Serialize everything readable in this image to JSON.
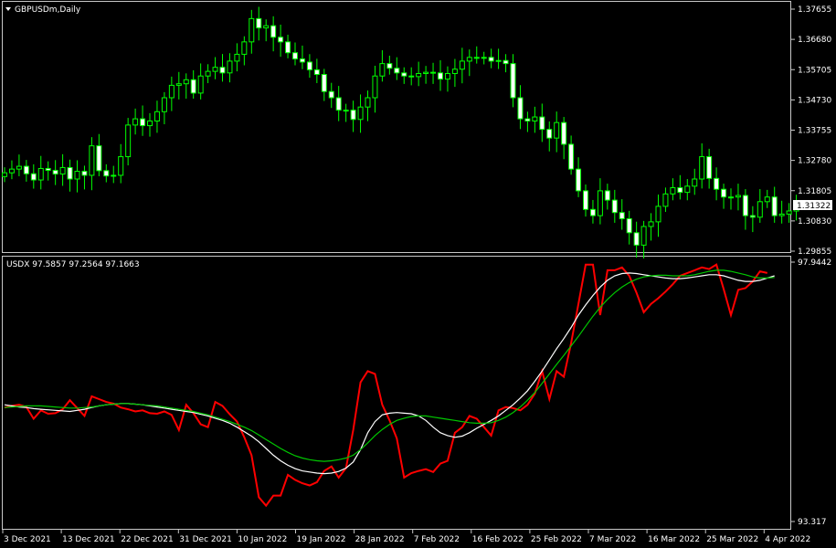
{
  "window": {
    "main_title": "GBPUSDm,Daily",
    "indicator_title": "USDX 97.5857 97.2564 97.1663"
  },
  "colors": {
    "background": "#000000",
    "frame": "#c8c8c8",
    "candle": "#00ff00",
    "candle_bull_body": "#000000",
    "candle_bear_body": "#ffffff",
    "line_red": "#ff0000",
    "line_white": "#ffffff",
    "line_green": "#00c800",
    "current_price_bg": "#ffffff",
    "current_price_text": "#000000"
  },
  "chart_data": [
    {
      "type": "candlestick",
      "title": "GBPUSDm,Daily",
      "x_ticks": [
        "3 Dec 2021",
        "13 Dec 2021",
        "22 Dec 2021",
        "31 Dec 2021",
        "10 Jan 2022",
        "19 Jan 2022",
        "28 Jan 2022",
        "7 Feb 2022",
        "16 Feb 2022",
        "25 Feb 2022",
        "7 Mar 2022",
        "16 Mar 2022",
        "25 Mar 2022",
        "4 Apr 2022"
      ],
      "y_ticks": [
        "1.37655",
        "1.36680",
        "1.35705",
        "1.34730",
        "1.33755",
        "1.32780",
        "1.31805",
        "1.30830",
        "1.29855"
      ],
      "ylim": [
        1.29855,
        1.37655
      ],
      "current_price": "1.31322",
      "close": [
        1.3238,
        1.325,
        1.3259,
        1.3235,
        1.3215,
        1.3252,
        1.3246,
        1.3234,
        1.3255,
        1.3218,
        1.3243,
        1.323,
        1.3325,
        1.3245,
        1.3228,
        1.323,
        1.329,
        1.3392,
        1.3412,
        1.339,
        1.3405,
        1.3435,
        1.348,
        1.352,
        1.3525,
        1.3538,
        1.3495,
        1.355,
        1.3565,
        1.3578,
        1.356,
        1.3598,
        1.362,
        1.366,
        1.3735,
        1.3705,
        1.3712,
        1.3675,
        1.366,
        1.3625,
        1.3605,
        1.3595,
        1.357,
        1.3555,
        1.35,
        1.348,
        1.344,
        1.344,
        1.341,
        1.345,
        1.348,
        1.355,
        1.359,
        1.3575,
        1.356,
        1.355,
        1.3548,
        1.3558,
        1.3562,
        1.356,
        1.354,
        1.3558,
        1.3572,
        1.3598,
        1.361,
        1.3608,
        1.361,
        1.3598,
        1.36,
        1.359,
        1.348,
        1.3412,
        1.3405,
        1.3418,
        1.3378,
        1.335,
        1.34,
        1.333,
        1.325,
        1.318,
        1.312,
        1.31,
        1.318,
        1.315,
        1.311,
        1.309,
        1.3045,
        1.3005,
        1.3065,
        1.308,
        1.313,
        1.317,
        1.319,
        1.3175,
        1.3195,
        1.3218,
        1.329,
        1.322,
        1.3185,
        1.316,
        1.316,
        1.3165,
        1.31,
        1.3095,
        1.3145,
        1.316,
        1.31,
        1.3105,
        1.3115,
        1.3132
      ]
    },
    {
      "type": "line",
      "title": "USDX 97.5857 97.2564 97.1663",
      "x_ticks": [],
      "y_ticks": [
        "97.9442",
        "93.317"
      ],
      "ylim": [
        93.317,
        97.9442
      ],
      "series": [
        {
          "color": "#ff0000",
          "values": [
            95.35,
            95.38,
            95.4,
            95.36,
            95.15,
            95.3,
            95.24,
            95.25,
            95.32,
            95.48,
            95.34,
            95.2,
            95.55,
            95.5,
            95.45,
            95.42,
            95.35,
            95.32,
            95.28,
            95.3,
            95.25,
            95.24,
            95.28,
            95.22,
            94.95,
            95.4,
            95.25,
            95.05,
            95.0,
            95.45,
            95.38,
            95.23,
            95.1,
            94.82,
            94.5,
            93.75,
            93.6,
            93.78,
            93.78,
            94.15,
            94.06,
            94.0,
            93.96,
            94.02,
            94.22,
            94.3,
            94.1,
            94.27,
            94.95,
            95.8,
            96.0,
            95.95,
            95.4,
            95.12,
            94.8,
            94.1,
            94.18,
            94.22,
            94.25,
            94.2,
            94.35,
            94.4,
            94.9,
            95.0,
            95.2,
            95.15,
            95.0,
            94.85,
            95.3,
            95.36,
            95.34,
            95.3,
            95.4,
            95.6,
            96.0,
            95.5,
            96.0,
            95.9,
            96.5,
            97.2,
            97.9,
            97.9,
            97.0,
            97.8,
            97.8,
            97.85,
            97.7,
            97.4,
            97.05,
            97.2,
            97.3,
            97.42,
            97.55,
            97.7,
            97.75,
            97.8,
            97.85,
            97.82,
            97.9,
            97.46,
            97.0,
            97.45,
            97.48,
            97.6,
            97.78,
            97.75
          ]
        },
        {
          "color": "#ffffff",
          "values": [
            95.4,
            95.38,
            95.36,
            95.35,
            95.33,
            95.32,
            95.31,
            95.3,
            95.29,
            95.28,
            95.3,
            95.32,
            95.35,
            95.38,
            95.4,
            95.41,
            95.42,
            95.42,
            95.41,
            95.4,
            95.38,
            95.36,
            95.34,
            95.32,
            95.3,
            95.28,
            95.26,
            95.23,
            95.2,
            95.16,
            95.12,
            95.07,
            95.0,
            94.92,
            94.84,
            94.74,
            94.62,
            94.5,
            94.4,
            94.32,
            94.26,
            94.22,
            94.2,
            94.18,
            94.17,
            94.18,
            94.21,
            94.27,
            94.38,
            94.6,
            94.9,
            95.1,
            95.22,
            95.25,
            95.26,
            95.25,
            95.24,
            95.2,
            95.12,
            95.0,
            94.9,
            94.85,
            94.82,
            94.84,
            94.9,
            94.98,
            95.05,
            95.12,
            95.2,
            95.3,
            95.4,
            95.52,
            95.65,
            95.82,
            96.0,
            96.2,
            96.4,
            96.58,
            96.78,
            97.0,
            97.18,
            97.35,
            97.5,
            97.62,
            97.7,
            97.74,
            97.75,
            97.74,
            97.72,
            97.7,
            97.68,
            97.66,
            97.65,
            97.65,
            97.66,
            97.68,
            97.7,
            97.72,
            97.72,
            97.7,
            97.66,
            97.62,
            97.6,
            97.6,
            97.62,
            97.66,
            97.7
          ]
        },
        {
          "color": "#00c800",
          "values": [
            95.35,
            95.36,
            95.37,
            95.38,
            95.38,
            95.38,
            95.37,
            95.36,
            95.35,
            95.34,
            95.34,
            95.35,
            95.36,
            95.38,
            95.4,
            95.41,
            95.42,
            95.42,
            95.41,
            95.4,
            95.39,
            95.38,
            95.36,
            95.34,
            95.32,
            95.3,
            95.28,
            95.25,
            95.22,
            95.18,
            95.14,
            95.1,
            95.05,
            95.0,
            94.94,
            94.86,
            94.78,
            94.7,
            94.62,
            94.55,
            94.49,
            94.45,
            94.42,
            94.4,
            94.39,
            94.4,
            94.42,
            94.45,
            94.5,
            94.6,
            94.72,
            94.85,
            94.96,
            95.05,
            95.12,
            95.16,
            95.19,
            95.2,
            95.2,
            95.18,
            95.16,
            95.14,
            95.12,
            95.1,
            95.08,
            95.07,
            95.07,
            95.08,
            95.12,
            95.18,
            95.26,
            95.36,
            95.48,
            95.62,
            95.78,
            95.95,
            96.12,
            96.28,
            96.45,
            96.62,
            96.8,
            96.98,
            97.14,
            97.28,
            97.4,
            97.5,
            97.58,
            97.64,
            97.68,
            97.7,
            97.71,
            97.71,
            97.7,
            97.7,
            97.7,
            97.72,
            97.75,
            97.78,
            97.8,
            97.8,
            97.78,
            97.75,
            97.72,
            97.68,
            97.66,
            97.66,
            97.67
          ]
        }
      ]
    }
  ]
}
